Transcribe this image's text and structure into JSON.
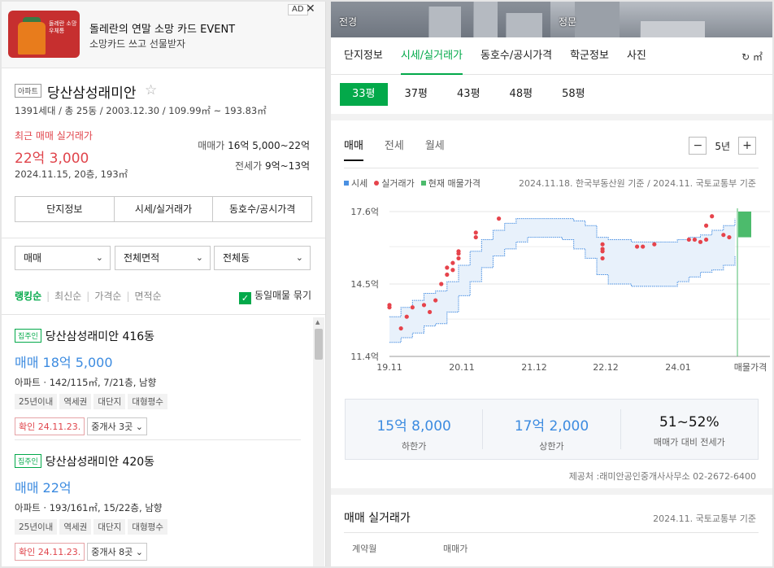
{
  "ad": {
    "title": "돌레란의 연말 소망 카드 EVENT",
    "subtitle": "소망카드 쓰고 선물받자",
    "badge": "AD",
    "close": "✕",
    "thumb_text": "돌레란 소망우체통"
  },
  "complex": {
    "type_tag": "아파트",
    "name": "당산삼성래미안",
    "star": "☆",
    "info": "1391세대 / 총 25동 / 2003.12.30 / 109.99㎡ ~ 193.83㎡",
    "recent_label": "최근 매매 실거래가",
    "recent_price": "22억 3,000",
    "recent_detail": "2024.11.15, 20층, 193㎡",
    "sale_label": "매매가",
    "sale_range": "16억 5,000~22억",
    "jeonse_label": "전세가",
    "jeonse_range": "9억~13억"
  },
  "left_tabs": [
    "단지정보",
    "시세/실거래가",
    "동호수/공시가격"
  ],
  "filters": {
    "deal": "매매",
    "area": "전체면적",
    "dong": "전체동",
    "chev": "⌄"
  },
  "sort": {
    "ranking": "랭킹순",
    "latest": "최신순",
    "price": "가격순",
    "area": "면적순",
    "same_group": "동일매물 묶기",
    "check": "✓"
  },
  "listings": [
    {
      "owner": "집주인",
      "name": "당산삼성래미안 416동",
      "price": "매매 18억 5,000",
      "info": "아파트 · 142/115㎡, 7/21층, 남향",
      "tags": [
        "25년이내",
        "역세권",
        "대단지",
        "대형평수"
      ],
      "confirm": "확인 24.11.23.",
      "brokers": "중개사 3곳 ⌄"
    },
    {
      "owner": "집주인",
      "name": "당산삼성래미안 420동",
      "price": "매매 22억",
      "info": "아파트 · 193/161㎡, 15/22층, 남향",
      "tags": [
        "25년이내",
        "역세권",
        "대단지",
        "대형평수"
      ],
      "confirm": "확인 24.11.23.",
      "brokers": "중개사 8곳 ⌄"
    }
  ],
  "photos": {
    "left": "전경",
    "right": "정문"
  },
  "right_tabs": [
    "단지정보",
    "시세/실거래가",
    "동호수/공시가격",
    "학군정보",
    "사진"
  ],
  "unit_toggle": "↻ ㎡",
  "pyeong": [
    "33평",
    "37평",
    "43평",
    "48평",
    "58평"
  ],
  "chart_tabs": [
    "매매",
    "전세",
    "월세"
  ],
  "period": {
    "minus": "−",
    "value": "5년",
    "plus": "+"
  },
  "legend": {
    "market": "시세",
    "actual": "실거래가",
    "listing": "현재 매물가격"
  },
  "source_note": "2024.11.18. 한국부동산원 기준 / 2024.11. 국토교통부 기준",
  "colors": {
    "accent": "#03a94a",
    "price_blue": "#3c8be0",
    "recent_red": "#e0454c",
    "market_line": "#4a90e2",
    "actual_dot": "#e6434b",
    "listing_bar": "#4cbb6c"
  },
  "chart_data": {
    "type": "area",
    "title": "",
    "y_ticks": [
      "17.6억",
      "14.5억",
      "11.4억"
    ],
    "ylim": [
      11.4,
      17.6
    ],
    "y_unit": "억",
    "x_ticks": [
      "19.11",
      "20.11",
      "21.12",
      "22.12",
      "24.01",
      "매물가격"
    ],
    "series": [
      {
        "name": "시세",
        "x": [
          "19.11",
          "20.01",
          "20.03",
          "20.05",
          "20.07",
          "20.09",
          "20.11",
          "21.01",
          "21.03",
          "21.05",
          "21.07",
          "21.09",
          "21.11",
          "22.01",
          "22.03",
          "22.05",
          "22.07",
          "22.09",
          "22.11",
          "23.01",
          "23.03",
          "23.05",
          "23.07",
          "23.09",
          "23.11",
          "24.01",
          "24.03",
          "24.05",
          "24.07",
          "24.09",
          "24.11"
        ],
        "upper": [
          13.1,
          13.5,
          13.8,
          14.1,
          14.2,
          14.6,
          15.3,
          15.9,
          16.4,
          16.8,
          17.1,
          17.3,
          17.3,
          17.3,
          17.3,
          17.3,
          17.2,
          17.0,
          16.5,
          16.4,
          16.4,
          16.3,
          16.3,
          16.3,
          16.3,
          16.4,
          16.5,
          16.6,
          16.8,
          17.0,
          17.3
        ],
        "lower": [
          12.0,
          12.2,
          12.4,
          12.7,
          12.8,
          13.3,
          14.0,
          14.6,
          15.2,
          15.7,
          16.0,
          16.3,
          16.5,
          16.5,
          16.5,
          16.4,
          16.0,
          15.6,
          14.9,
          14.5,
          14.5,
          14.4,
          14.4,
          14.4,
          14.4,
          14.6,
          14.8,
          15.0,
          15.1,
          15.3,
          15.7
        ]
      },
      {
        "name": "실거래가",
        "points": [
          [
            "19.11",
            13.5
          ],
          [
            "19.11",
            13.6
          ],
          [
            "20.01",
            12.6
          ],
          [
            "20.02",
            13.1
          ],
          [
            "20.03",
            13.5
          ],
          [
            "20.05",
            13.6
          ],
          [
            "20.06",
            13.3
          ],
          [
            "20.07",
            13.8
          ],
          [
            "20.08",
            14.5
          ],
          [
            "20.09",
            14.9
          ],
          [
            "20.09",
            15.2
          ],
          [
            "20.10",
            15.4
          ],
          [
            "20.10",
            15.1
          ],
          [
            "20.11",
            15.6
          ],
          [
            "20.11",
            15.8
          ],
          [
            "20.11",
            15.9
          ],
          [
            "21.02",
            16.5
          ],
          [
            "21.02",
            16.7
          ],
          [
            "21.06",
            17.3
          ],
          [
            "22.12",
            15.6
          ],
          [
            "22.12",
            15.9
          ],
          [
            "22.12",
            16.0
          ],
          [
            "22.12",
            16.2
          ],
          [
            "23.06",
            16.1
          ],
          [
            "23.07",
            16.1
          ],
          [
            "23.09",
            16.2
          ],
          [
            "24.03",
            16.4
          ],
          [
            "24.04",
            16.4
          ],
          [
            "24.05",
            16.3
          ],
          [
            "24.06",
            17.0
          ],
          [
            "24.06",
            16.4
          ],
          [
            "24.07",
            17.4
          ],
          [
            "24.09",
            16.6
          ],
          [
            "24.10",
            16.5
          ]
        ]
      },
      {
        "name": "현재 매물가격",
        "range": [
          16.5,
          17.6
        ]
      }
    ]
  },
  "stats": [
    {
      "value": "15억 8,000",
      "label": "하한가"
    },
    {
      "value": "17억 2,000",
      "label": "상한가"
    },
    {
      "value": "51~52%",
      "label": "매매가 대비 전세가"
    }
  ],
  "provider": "제공처 :래미안공인중개사사무소 02-2672-6400",
  "trade": {
    "title": "매매 실거래가",
    "source": "2024.11. 국토교통부 기준",
    "col_month": "계약월",
    "col_price": "매매가"
  }
}
